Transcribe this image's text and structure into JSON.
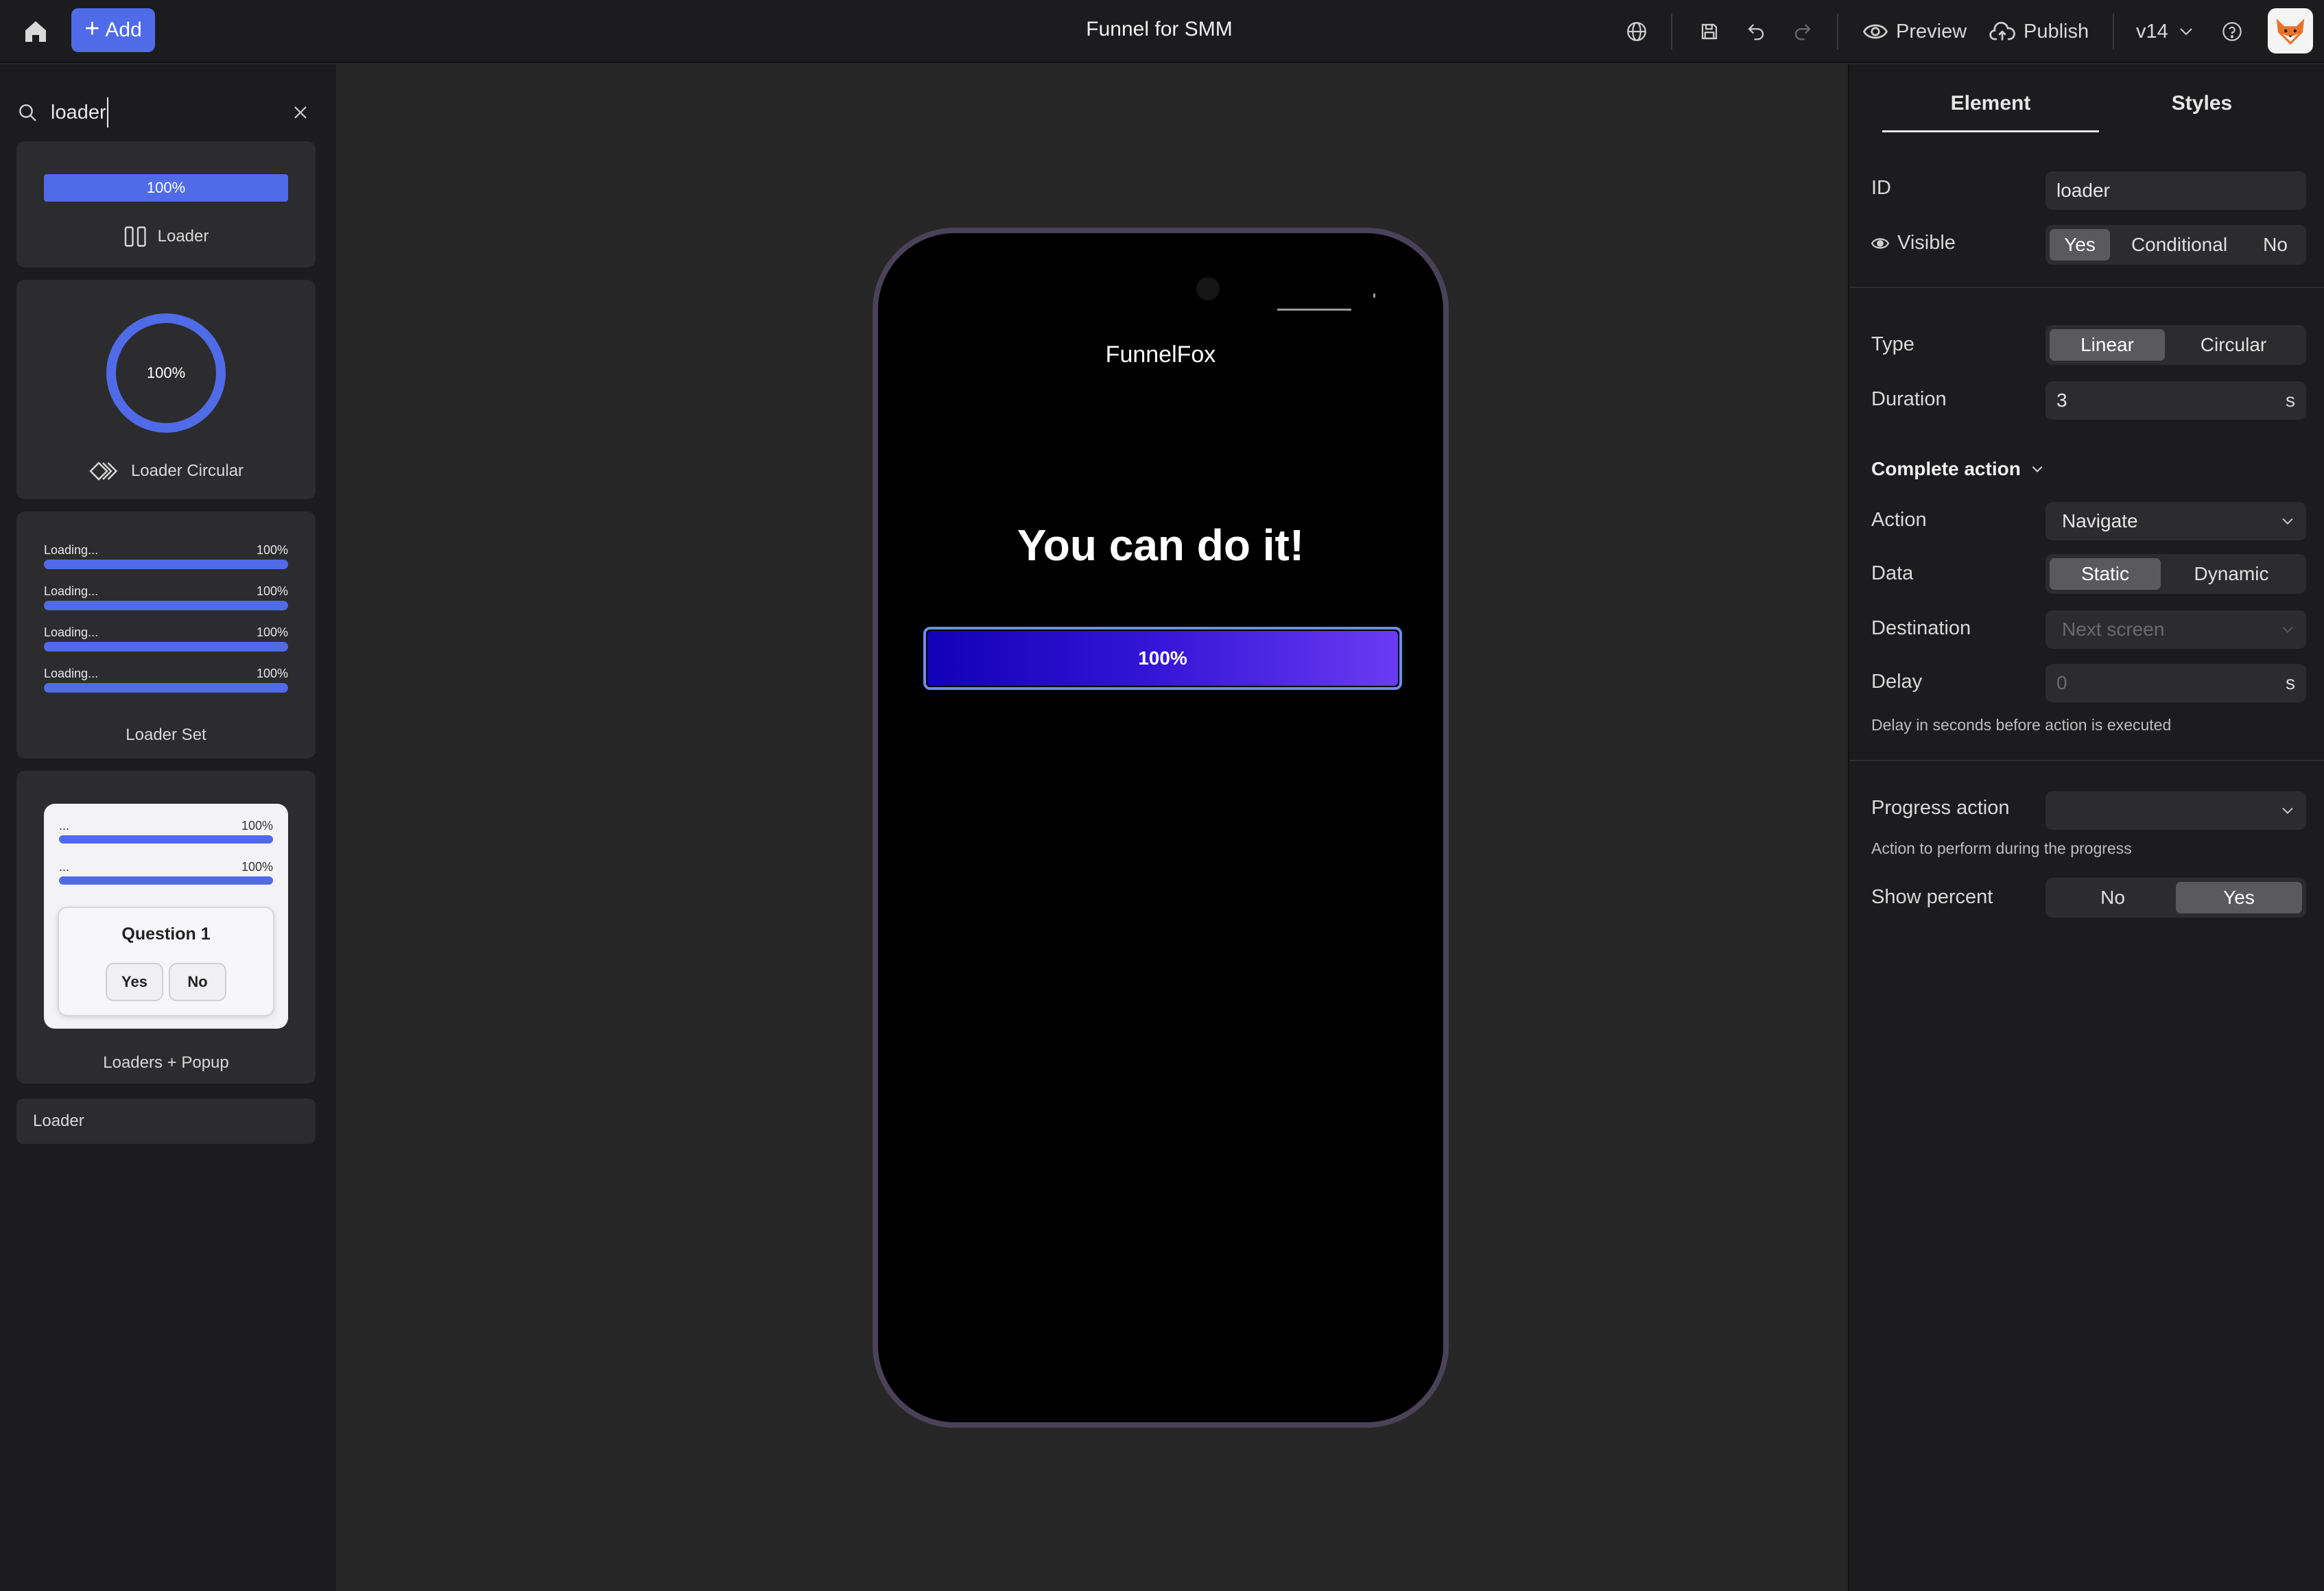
{
  "topbar": {
    "add_label": "Add",
    "title": "Funnel for SMM",
    "preview_label": "Preview",
    "publish_label": "Publish",
    "version_label": "v14"
  },
  "sidebar": {
    "search": {
      "value": "loader",
      "placeholder": ""
    },
    "cards": {
      "loader": {
        "label": "Loader",
        "percent": "100%"
      },
      "loader_circular": {
        "label": "Loader Circular",
        "percent": "100%"
      },
      "loader_set": {
        "label": "Loader Set",
        "rows": [
          {
            "label": "Loading...",
            "percent": "100%"
          },
          {
            "label": "Loading...",
            "percent": "100%"
          },
          {
            "label": "Loading...",
            "percent": "100%"
          },
          {
            "label": "Loading...",
            "percent": "100%"
          }
        ]
      },
      "loaders_popup": {
        "label": "Loaders + Popup",
        "rows": [
          {
            "label": "...",
            "percent": "100%"
          },
          {
            "label": "...",
            "percent": "100%"
          }
        ],
        "question": "Question 1",
        "yes": "Yes",
        "no": "No"
      }
    },
    "result_item": "Loader"
  },
  "phone": {
    "brand": "FunnelFox",
    "heading": "You can do it!",
    "loader_percent": "100%",
    "progress": 1.0
  },
  "panel": {
    "tabs": {
      "element": "Element",
      "styles": "Styles"
    },
    "id_label": "ID",
    "id_value": "loader",
    "visible_label": "Visible",
    "visible_options": [
      "Yes",
      "Conditional",
      "No"
    ],
    "type_label": "Type",
    "type_options": [
      "Linear",
      "Circular"
    ],
    "duration_label": "Duration",
    "duration_value": "3",
    "duration_unit": "s",
    "complete_action_label": "Complete action",
    "action_label": "Action",
    "action_value": "Navigate",
    "data_label": "Data",
    "data_options": [
      "Static",
      "Dynamic"
    ],
    "destination_label": "Destination",
    "destination_placeholder": "Next screen",
    "delay_label": "Delay",
    "delay_placeholder": "0",
    "delay_unit": "s",
    "delay_hint": "Delay in seconds before action is executed",
    "progress_action_label": "Progress action",
    "progress_action_hint": "Action to perform during the progress",
    "show_percent_label": "Show percent",
    "show_percent_options": [
      "No",
      "Yes"
    ]
  },
  "colors": {
    "accent": "#4f6be8",
    "gradient_start": "#1200b8",
    "gradient_end": "#6a3bf2",
    "phone_frame": "#4a4258"
  }
}
